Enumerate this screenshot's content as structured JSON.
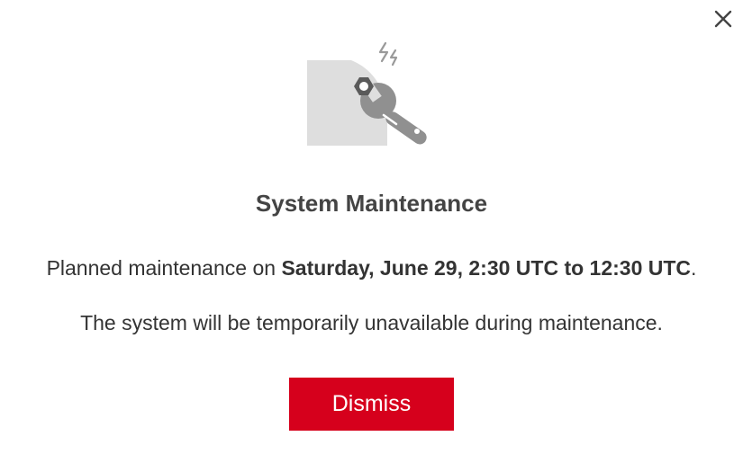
{
  "dialog": {
    "title": "System Maintenance",
    "message": {
      "prefix": "Planned maintenance on ",
      "emphasis": "Saturday, June 29, 2:30 UTC to 12:30 UTC",
      "suffix": "."
    },
    "detail": "The system will be temporarily unavailable during maintenance.",
    "dismiss_label": "Dismiss",
    "close_icon": "close-icon",
    "illustration_icon": "wrench-nut-icon"
  },
  "colors": {
    "accent": "#d6001c",
    "title_text": "#444444",
    "body_text": "#333333",
    "icon_gray": "#8c8c8c",
    "panel_gray": "#dedede"
  }
}
